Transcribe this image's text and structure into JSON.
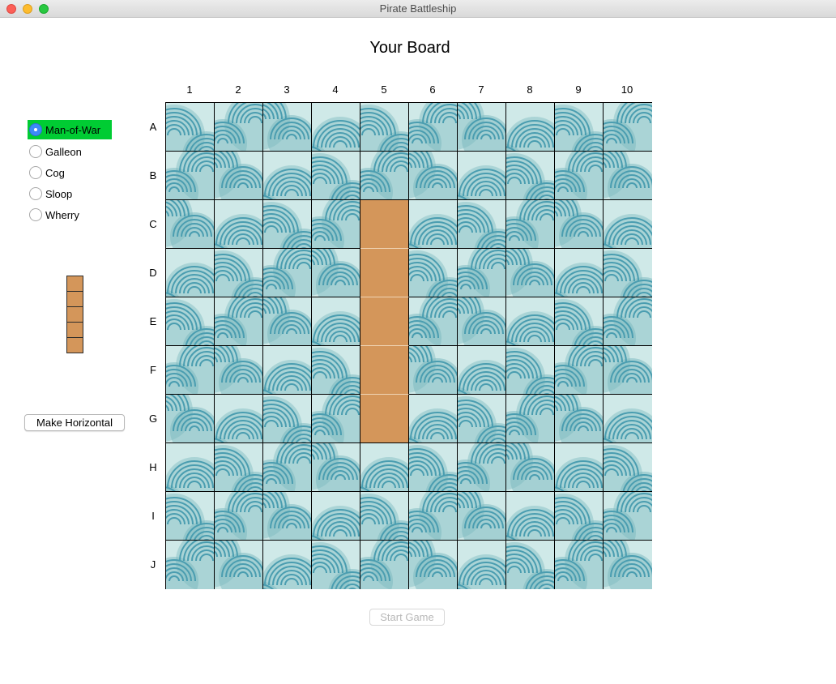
{
  "window": {
    "title": "Pirate Battleship"
  },
  "board": {
    "title": "Your Board",
    "columns": [
      "1",
      "2",
      "3",
      "4",
      "5",
      "6",
      "7",
      "8",
      "9",
      "10"
    ],
    "rows": [
      "A",
      "B",
      "C",
      "D",
      "E",
      "F",
      "G",
      "H",
      "I",
      "J"
    ],
    "placed_ship_cells": [
      "C5",
      "D5",
      "E5",
      "F5",
      "G5"
    ]
  },
  "ships": [
    {
      "label": "Man-of-War",
      "selected": true
    },
    {
      "label": "Galleon",
      "selected": false
    },
    {
      "label": "Cog",
      "selected": false
    },
    {
      "label": "Sloop",
      "selected": false
    },
    {
      "label": "Wherry",
      "selected": false
    }
  ],
  "preview_length": 5,
  "buttons": {
    "orientation": "Make Horizontal",
    "start": "Start Game"
  },
  "colors": {
    "ship": "#d4965a",
    "selected_highlight": "#00cc33",
    "wave": "#4a9db0"
  }
}
